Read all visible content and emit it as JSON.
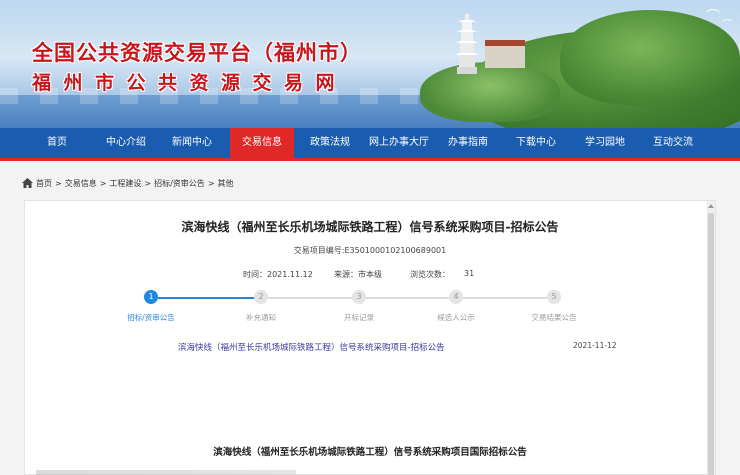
{
  "header": {
    "title_line1": "全国公共资源交易平台（福州市）",
    "title_line2": "福州市公共资源交易网"
  },
  "nav": {
    "items": [
      {
        "label": "首页",
        "active": false
      },
      {
        "label": "中心介绍",
        "active": false
      },
      {
        "label": "新闻中心",
        "active": false
      },
      {
        "label": "交易信息",
        "active": true
      },
      {
        "label": "政策法规",
        "active": false
      },
      {
        "label": "网上办事大厅",
        "active": false
      },
      {
        "label": "办事指南",
        "active": false
      },
      {
        "label": "下载中心",
        "active": false
      },
      {
        "label": "学习园地",
        "active": false
      },
      {
        "label": "互动交流",
        "active": false
      }
    ]
  },
  "breadcrumb": {
    "items": [
      "首页",
      "交易信息",
      "工程建设",
      "招标/资审公告",
      "其他"
    ],
    "separator": ">"
  },
  "article": {
    "title": "滨海快线（福州至长乐机场城际铁路工程）信号系统采购项目-招标公告",
    "project_no": "交易项目编号:E3501000102100689001",
    "time_label": "时间：2021.11.12",
    "source_label": "来源：市本级",
    "views_label": "浏览次数：",
    "views_count": "31"
  },
  "steps": {
    "items": [
      {
        "num": "1",
        "label": "招标/资审公告",
        "active": true
      },
      {
        "num": "2",
        "label": "补充通知",
        "active": false
      },
      {
        "num": "3",
        "label": "开标记录",
        "active": false
      },
      {
        "num": "4",
        "label": "候选人公示",
        "active": false
      },
      {
        "num": "5",
        "label": "交易结果公告",
        "active": false
      }
    ]
  },
  "notice": {
    "link_text": "滨海快线（福州至长乐机场城际铁路工程）信号系统采购项目-招标公告",
    "date": "2021-11-12"
  },
  "body": {
    "title": "滨海快线（福州至长乐机场城际铁路工程）信号系统采购项目国际招标公告"
  },
  "colors": {
    "nav_bg": "#1a5cb0",
    "nav_active": "#e02828",
    "title_red": "#c8161d",
    "step_active": "#1e88e5",
    "link": "#3a3aa0"
  }
}
